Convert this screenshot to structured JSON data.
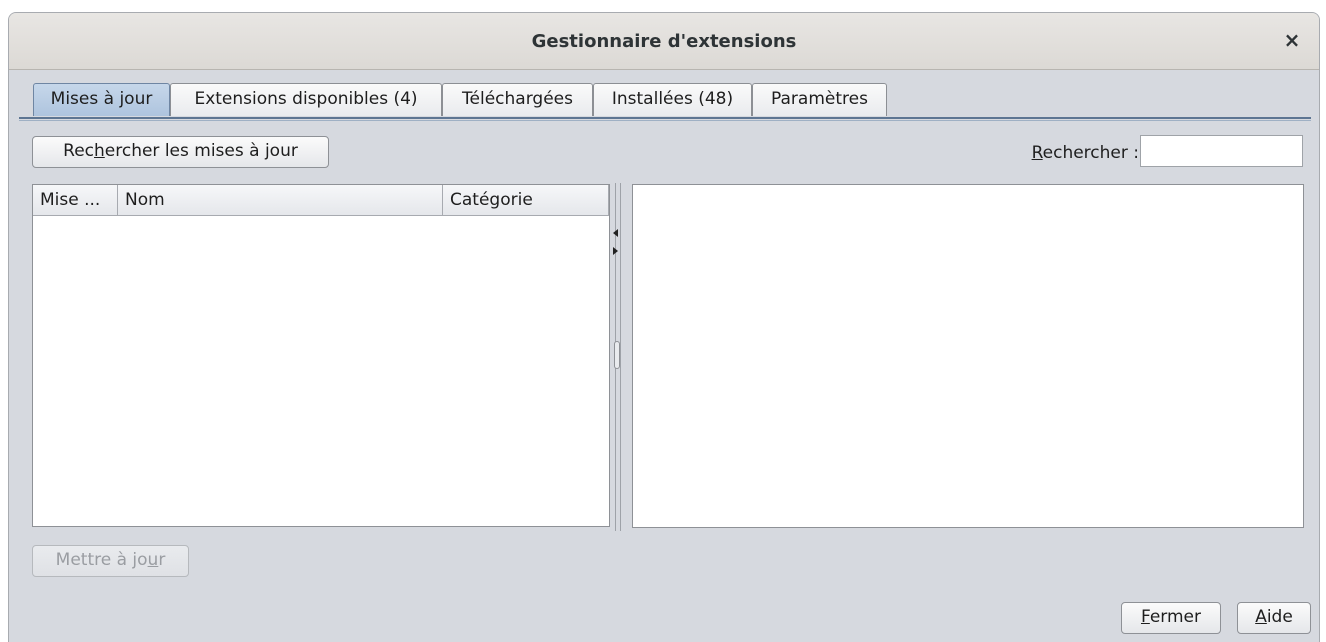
{
  "window": {
    "title": "Gestionnaire d'extensions",
    "close_label": "×"
  },
  "tabs": [
    {
      "label": "Mises à jour",
      "active": true
    },
    {
      "label": "Extensions disponibles (4)",
      "active": false
    },
    {
      "label": "Téléchargées",
      "active": false
    },
    {
      "label": "Installées (48)",
      "active": false
    },
    {
      "label": "Paramètres",
      "active": false
    }
  ],
  "toolbar": {
    "check_button": {
      "pre": "Rec",
      "mnemonic": "h",
      "post": "ercher les mises à jour"
    },
    "search": {
      "mnemonic": "R",
      "label_rest": "echercher :",
      "value": ""
    }
  },
  "table": {
    "columns": [
      "Mise ...",
      "Nom",
      "Catégorie"
    ],
    "rows": []
  },
  "buttons": {
    "update": {
      "pre": "Mettre à jo",
      "mnemonic": "u",
      "post": "r",
      "enabled": false
    },
    "close": {
      "mnemonic": "F",
      "post": "ermer"
    },
    "help": {
      "mnemonic": "A",
      "post": "ide"
    }
  },
  "colors": {
    "active_tab": "#b8cce4",
    "tab_rule": "#5d7592",
    "window_bg": "#d6d9df"
  }
}
